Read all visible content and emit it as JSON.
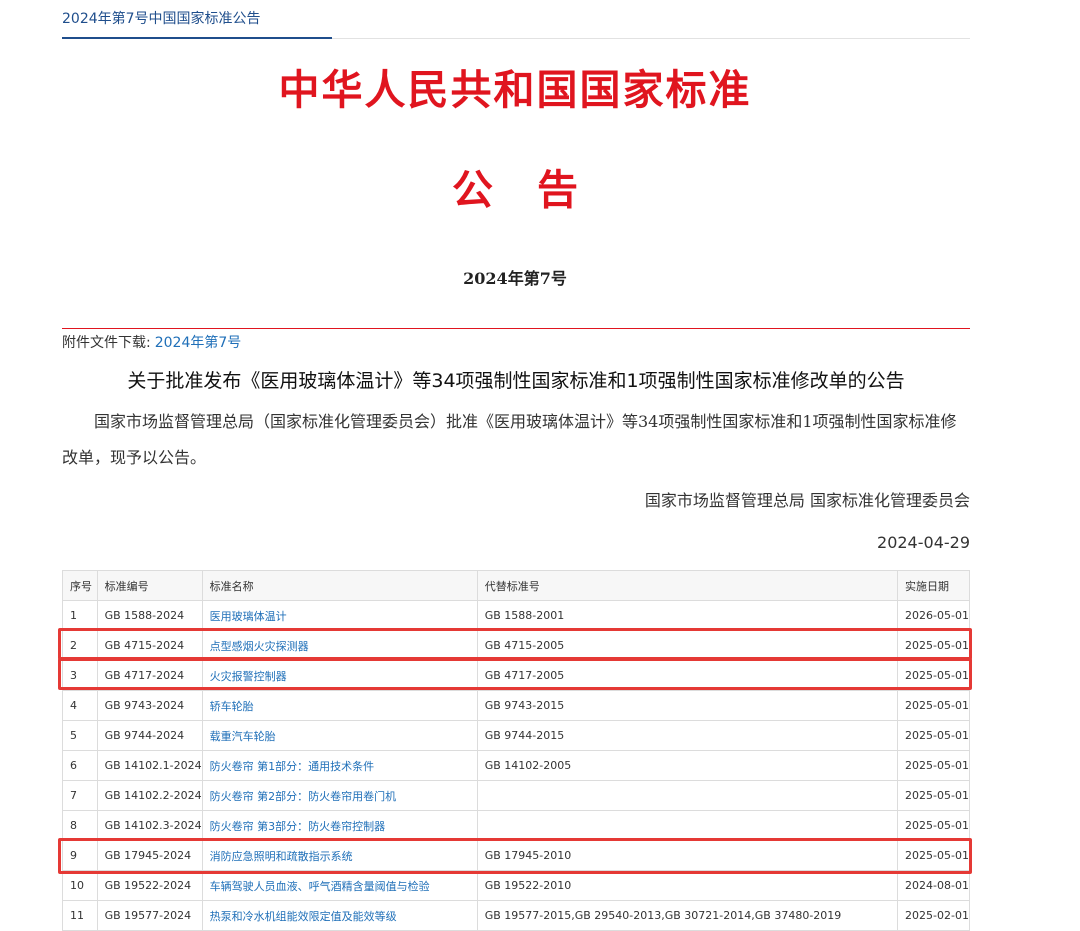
{
  "header": {
    "tab_label": "2024年第7号中国国家标准公告"
  },
  "headline": "中华人民共和国国家标准",
  "gonggao": "公告",
  "issue_no": "2024年第7号",
  "attachment": {
    "label": "附件文件下载:",
    "link": "2024年第7号"
  },
  "article": {
    "title": "关于批准发布《医用玻璃体温计》等34项强制性国家标准和1项强制性国家标准修改单的公告",
    "body": "国家市场监督管理总局（国家标准化管理委员会）批准《医用玻璃体温计》等34项强制性国家标准和1项强制性国家标准修改单，现予以公告。",
    "issuer": "国家市场监督管理总局 国家标准化管理委员会",
    "date": "2024-04-29"
  },
  "table": {
    "headers": [
      "序号",
      "标准编号",
      "标准名称",
      "代替标准号",
      "实施日期"
    ],
    "rows": [
      [
        "1",
        "GB 1588-2024",
        "医用玻璃体温计",
        "GB 1588-2001",
        "2026-05-01"
      ],
      [
        "2",
        "GB 4715-2024",
        "点型感烟火灾探测器",
        "GB 4715-2005",
        "2025-05-01"
      ],
      [
        "3",
        "GB 4717-2024",
        "火灾报警控制器",
        "GB 4717-2005",
        "2025-05-01"
      ],
      [
        "4",
        "GB 9743-2024",
        "轿车轮胎",
        "GB 9743-2015",
        "2025-05-01"
      ],
      [
        "5",
        "GB 9744-2024",
        "载重汽车轮胎",
        "GB 9744-2015",
        "2025-05-01"
      ],
      [
        "6",
        "GB 14102.1-2024",
        "防火卷帘 第1部分：通用技术条件",
        "GB 14102-2005",
        "2025-05-01"
      ],
      [
        "7",
        "GB 14102.2-2024",
        "防火卷帘 第2部分：防火卷帘用卷门机",
        "",
        "2025-05-01"
      ],
      [
        "8",
        "GB 14102.3-2024",
        "防火卷帘 第3部分：防火卷帘控制器",
        "",
        "2025-05-01"
      ],
      [
        "9",
        "GB 17945-2024",
        "消防应急照明和疏散指示系统",
        "GB 17945-2010",
        "2025-05-01"
      ],
      [
        "10",
        "GB 19522-2024",
        "车辆驾驶人员血液、呼气酒精含量阈值与检验",
        "GB 19522-2010",
        "2024-08-01"
      ],
      [
        "11",
        "GB 19577-2024",
        "热泵和冷水机组能效限定值及能效等级",
        "GB 19577-2015,GB 29540-2013,GB 30721-2014,GB 37480-2019",
        "2025-02-01"
      ]
    ]
  },
  "highlight_color": "#e53935"
}
